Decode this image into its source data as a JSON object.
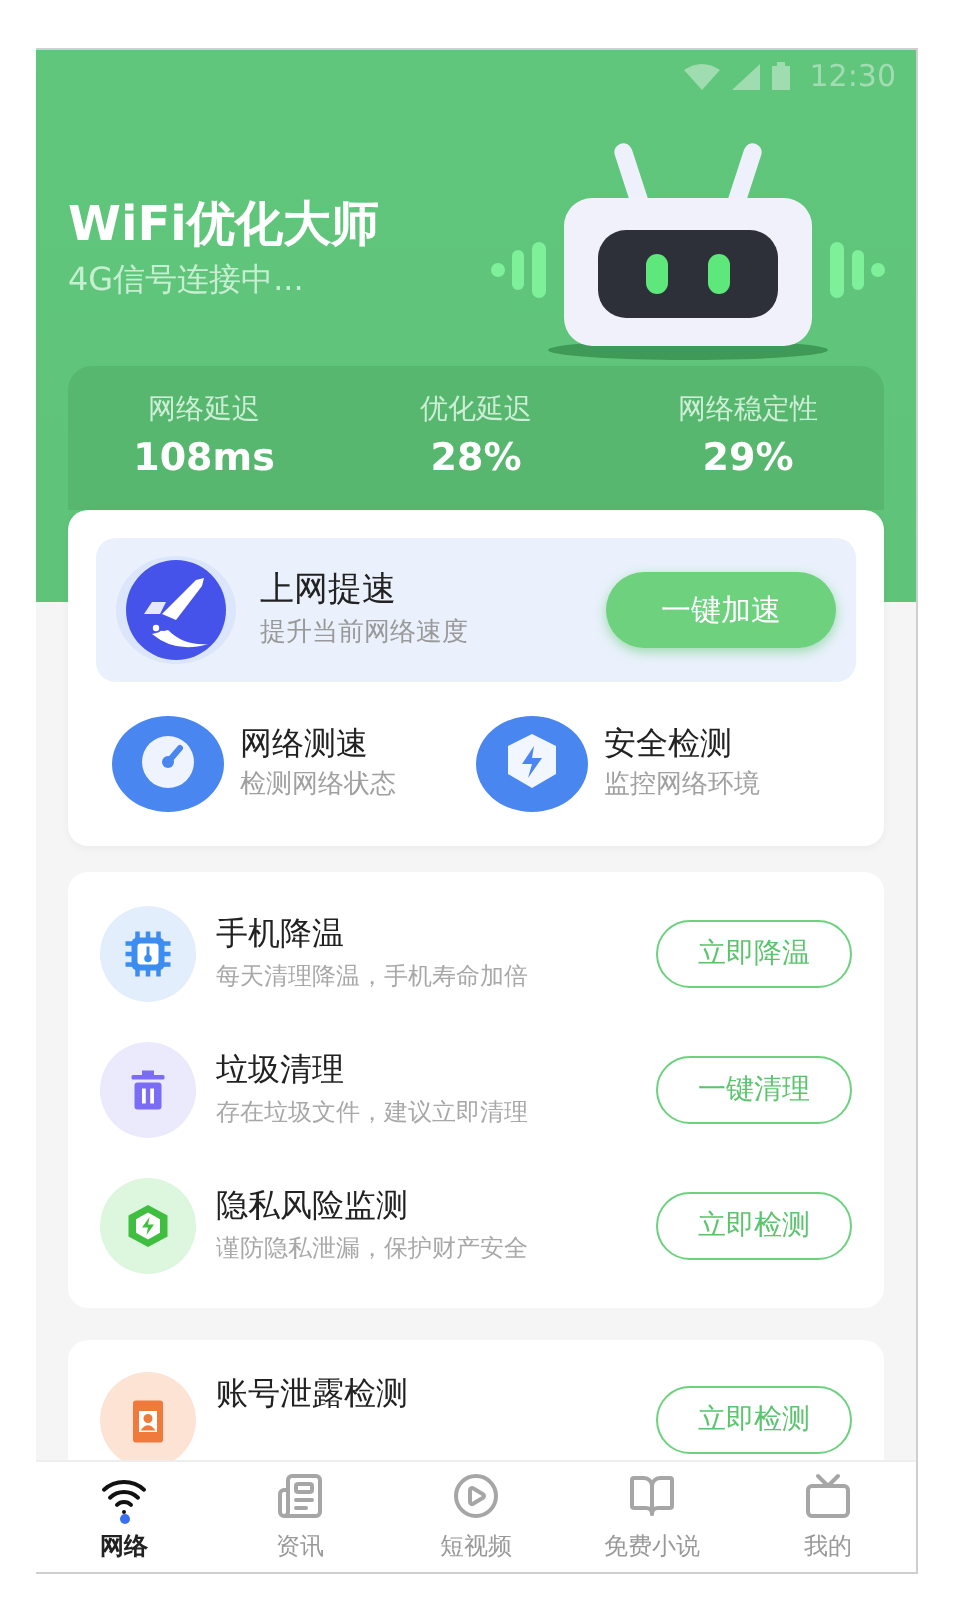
{
  "status_bar": {
    "time": "12:30"
  },
  "header": {
    "title": "WiFi优化大师",
    "subtitle": "4G信号连接中..."
  },
  "stats": [
    {
      "label": "网络延迟",
      "value": "108ms"
    },
    {
      "label": "优化延迟",
      "value": "28%"
    },
    {
      "label": "网络稳定性",
      "value": "29%"
    }
  ],
  "boost": {
    "title": "上网提速",
    "subtitle": "提升当前网络速度",
    "button": "一键加速"
  },
  "tools": [
    {
      "kind": "speed",
      "title": "网络测速",
      "subtitle": "检测网络状态"
    },
    {
      "kind": "security",
      "title": "安全检测",
      "subtitle": "监控网络环境"
    }
  ],
  "tasks": [
    {
      "kind": "cpu",
      "title": "手机降温",
      "subtitle": "每天清理降温，手机寿命加倍",
      "button": "立即降温"
    },
    {
      "kind": "trash",
      "title": "垃圾清理",
      "subtitle": "存在垃圾文件，建议立即清理",
      "button": "一键清理"
    },
    {
      "kind": "shield",
      "title": "隐私风险监测",
      "subtitle": "谨防隐私泄漏，保护财产安全",
      "button": "立即检测"
    }
  ],
  "more_tasks": [
    {
      "kind": "badge",
      "title": "账号泄露检测",
      "button": "立即检测"
    }
  ],
  "tabs": [
    {
      "kind": "wifi",
      "label": "网络",
      "selected": true
    },
    {
      "kind": "news",
      "label": "资讯",
      "selected": false
    },
    {
      "kind": "video",
      "label": "短视频",
      "selected": false
    },
    {
      "kind": "book",
      "label": "免费小说",
      "selected": false
    },
    {
      "kind": "tv",
      "label": "我的",
      "selected": false
    }
  ]
}
